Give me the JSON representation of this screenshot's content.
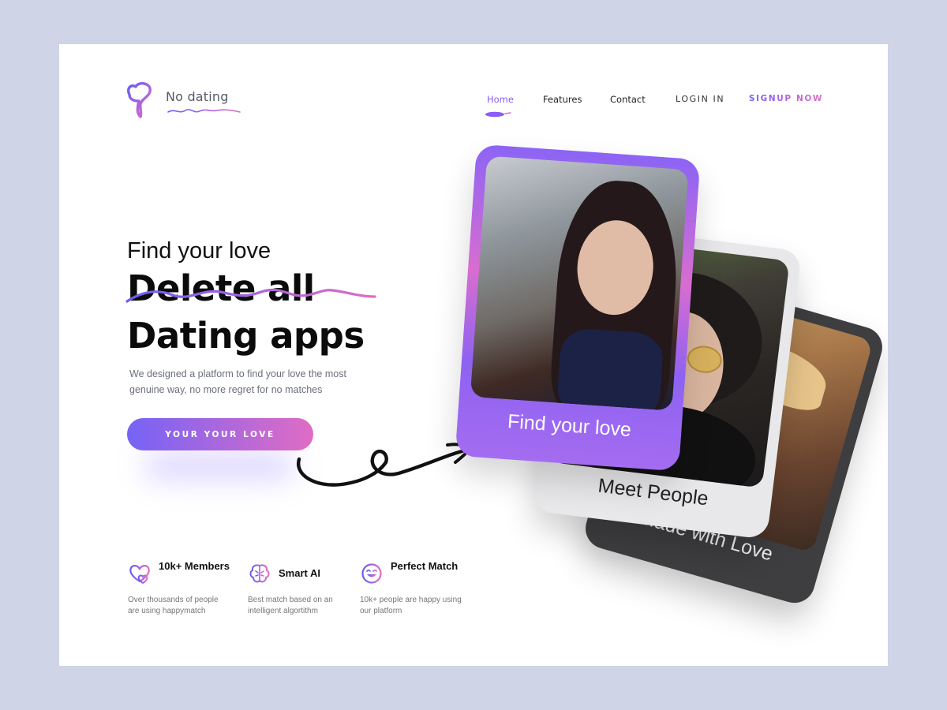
{
  "brand": {
    "name": "No dating"
  },
  "nav": {
    "home": "Home",
    "features": "Features",
    "contact": "Contact",
    "login": "LOGIN IN",
    "signup": "SIGNUP NOW"
  },
  "hero": {
    "kicker": "Find your love",
    "headline_line1": "Delete all",
    "headline_line2": "Dating apps",
    "description": "We designed a platform to find your love the most genuine way, no more regret for no matches",
    "cta_label": "YOUR YOUR LOVE"
  },
  "features": [
    {
      "icon": "hearts-icon",
      "title": "10k+ Members",
      "description": "Over thousands of people are using happymatch"
    },
    {
      "icon": "brain-icon",
      "title": "Smart AI",
      "description": "Best match based on an intelligent algortithm"
    },
    {
      "icon": "smile-icon",
      "title": "Perfect Match",
      "description": "10k+ people are happy using our platform"
    }
  ],
  "cards": [
    {
      "label": "Find your love"
    },
    {
      "label": "Meet People"
    },
    {
      "label": "Made with Love"
    }
  ],
  "colors": {
    "accent_purple": "#7c5cf7",
    "accent_pink": "#e06cc4",
    "page_background": "#cfd5e6"
  }
}
